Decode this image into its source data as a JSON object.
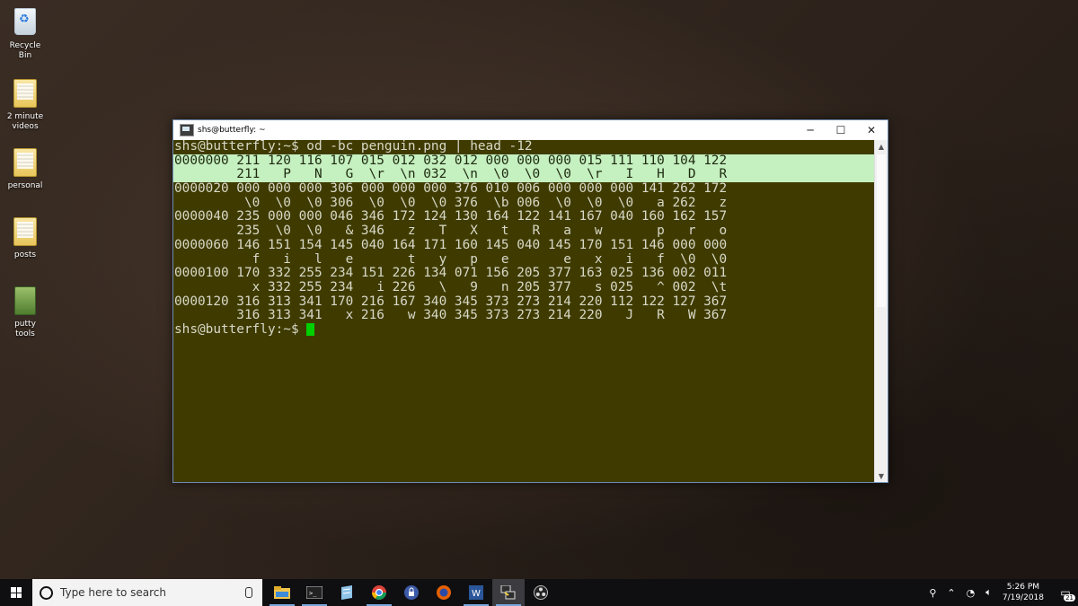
{
  "desktop": {
    "icons": [
      {
        "label": "Recycle Bin"
      },
      {
        "label": "2 minute videos"
      },
      {
        "label": "personal"
      },
      {
        "label": "posts"
      },
      {
        "label": "putty tools"
      }
    ]
  },
  "window": {
    "title": "shs@butterfly: ~",
    "buttons": {
      "minimize": "─",
      "maximize": "☐",
      "close": "✕"
    },
    "lines": [
      "shs@butterfly:~$ od -bc penguin.png | head -12",
      "0000000 211 120 116 107 015 012 032 012 000 000 000 015 111 110 104 122",
      "        211   P   N   G  \\r  \\n 032  \\n  \\0  \\0  \\0  \\r   I   H   D   R",
      "0000020 000 000 000 306 000 000 000 376 010 006 000 000 000 141 262 172",
      "         \\0  \\0  \\0 306  \\0  \\0  \\0 376  \\b 006  \\0  \\0  \\0   a 262   z",
      "0000040 235 000 000 046 346 172 124 130 164 122 141 167 040 160 162 157",
      "        235  \\0  \\0   & 346   z   T   X   t   R   a   w       p   r   o",
      "0000060 146 151 154 145 040 164 171 160 145 040 145 170 151 146 000 000",
      "          f   i   l   e       t   y   p   e       e   x   i   f  \\0  \\0",
      "0000100 170 332 255 234 151 226 134 071 156 205 377 163 025 136 002 011",
      "          x 332 255 234   i 226   \\   9   n 205 377   s 025   ^ 002  \\t",
      "0000120 316 313 341 170 216 167 340 345 373 273 214 220 112 122 127 367",
      "        316 313 341   x 216   w 340 345 373 273 214 220   J   R   W 367",
      "shs@butterfly:~$ "
    ]
  },
  "taskbar": {
    "search_placeholder": "Type here to search",
    "apps": [
      "file-explorer",
      "command-prompt",
      "notepad",
      "chrome",
      "keepass",
      "firefox",
      "word",
      "putty",
      "obs"
    ],
    "time": "5:26 PM",
    "date": "7/19/2018",
    "notification_count": "21"
  }
}
